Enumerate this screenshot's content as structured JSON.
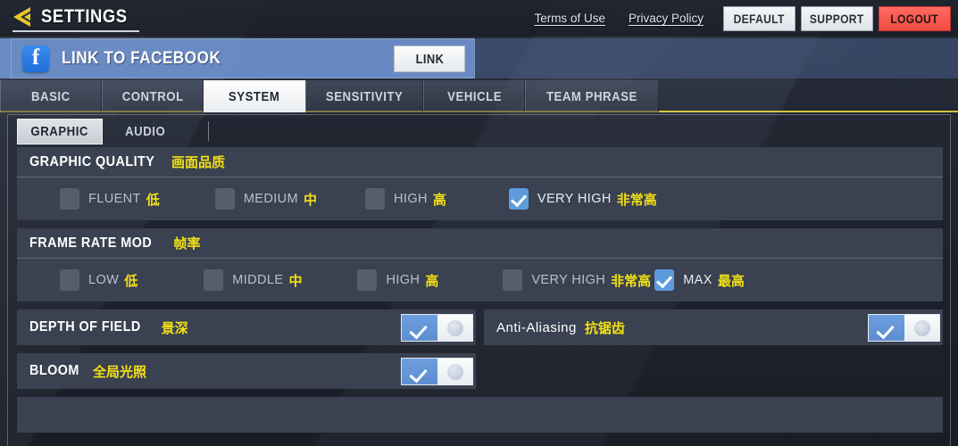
{
  "header": {
    "back_icon": "back-arrow-icon",
    "title": "SETTINGS",
    "terms_link": "Terms of Use",
    "privacy_link": "Privacy Policy",
    "default_button": "DEFAULT",
    "support_button": "SUPPORT",
    "logout_button": "LOGOUT"
  },
  "facebook_bar": {
    "icon": "facebook-icon",
    "icon_glyph": "f",
    "label": "LINK TO FACEBOOK",
    "button": "LINK"
  },
  "tabs": [
    {
      "label": "BASIC",
      "active": false
    },
    {
      "label": "CONTROL",
      "active": false
    },
    {
      "label": "SYSTEM",
      "active": true
    },
    {
      "label": "SENSITIVITY",
      "active": false
    },
    {
      "label": "VEHICLE",
      "active": false
    },
    {
      "label": "TEAM PHRASE",
      "active": false
    }
  ],
  "subtabs": [
    {
      "label": "GRAPHIC",
      "active": true
    },
    {
      "label": "AUDIO",
      "active": false
    }
  ],
  "sections": {
    "graphic_quality": {
      "title_en": "GRAPHIC QUALITY",
      "title_cn": "画面品质",
      "options": [
        {
          "en": "FLUENT",
          "cn": "低",
          "checked": false
        },
        {
          "en": "MEDIUM",
          "cn": "中",
          "checked": false
        },
        {
          "en": "HIGH",
          "cn": "高",
          "checked": false
        },
        {
          "en": "VERY HIGH",
          "cn": "非常高",
          "checked": true
        }
      ]
    },
    "frame_rate": {
      "title_en": "FRAME RATE MOD",
      "title_cn": "帧率",
      "options": [
        {
          "en": "LOW",
          "cn": "低",
          "checked": false
        },
        {
          "en": "MIDDLE",
          "cn": "中",
          "checked": false
        },
        {
          "en": "HIGH",
          "cn": "高",
          "checked": false
        },
        {
          "en": "VERY HIGH",
          "cn": "非常高",
          "checked": false
        },
        {
          "en": "MAX",
          "cn": "最高",
          "checked": true
        }
      ]
    }
  },
  "toggles": [
    {
      "en": "DEPTH OF FIELD",
      "cn": "景深",
      "on": true
    },
    {
      "en": "Anti-Aliasing",
      "cn": "抗锯齿",
      "on": true
    },
    {
      "en": "BLOOM",
      "cn": "全局光照",
      "on": true
    }
  ],
  "colors": {
    "accent_yellow": "#f2e015",
    "checkbox_blue": "#5e9bdc",
    "logout_red": "#f04b43",
    "facebook_blue": "#6e91cd",
    "card_bg": "#3a4150"
  }
}
